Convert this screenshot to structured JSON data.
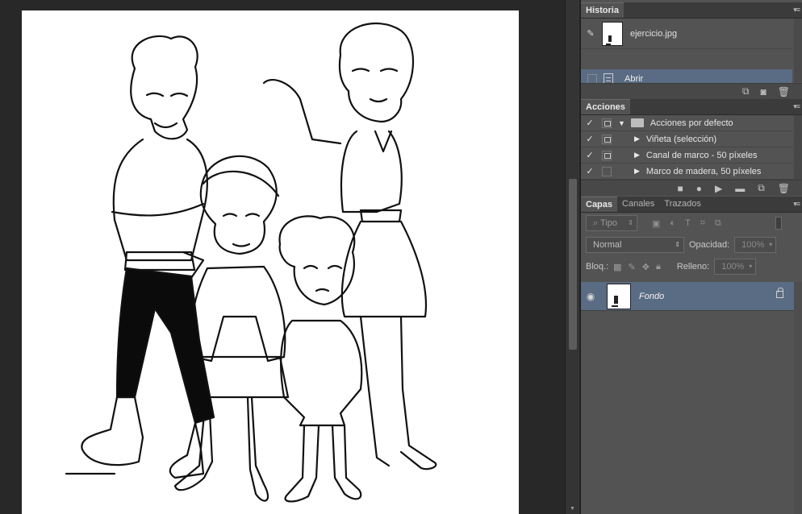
{
  "history_panel": {
    "tab": "Historia",
    "snapshot_name": "ejercicio.jpg",
    "states": [
      {
        "label": "Abrir"
      }
    ]
  },
  "actions_panel": {
    "tab": "Acciones",
    "items": [
      {
        "label": "Acciones por defecto",
        "type": "set"
      },
      {
        "label": "Viñeta (selección)",
        "type": "action"
      },
      {
        "label": "Canal de marco - 50 píxeles",
        "type": "action"
      },
      {
        "label": "Marco de madera, 50 píxeles",
        "type": "action"
      }
    ]
  },
  "layers_panel": {
    "tabs": [
      "Capas",
      "Canales",
      "Trazados"
    ],
    "filter_label": "Tipo",
    "blend_mode": "Normal",
    "opacity_label": "Opacidad:",
    "opacity_value": "100%",
    "lock_label": "Bloq.:",
    "fill_label": "Relleno:",
    "fill_value": "100%",
    "layers": [
      {
        "name": "Fondo",
        "locked": true,
        "visible": true
      }
    ]
  },
  "colors": {
    "panel_bg": "#535353",
    "selection": "#5a6c83",
    "workspace": "#282828"
  }
}
